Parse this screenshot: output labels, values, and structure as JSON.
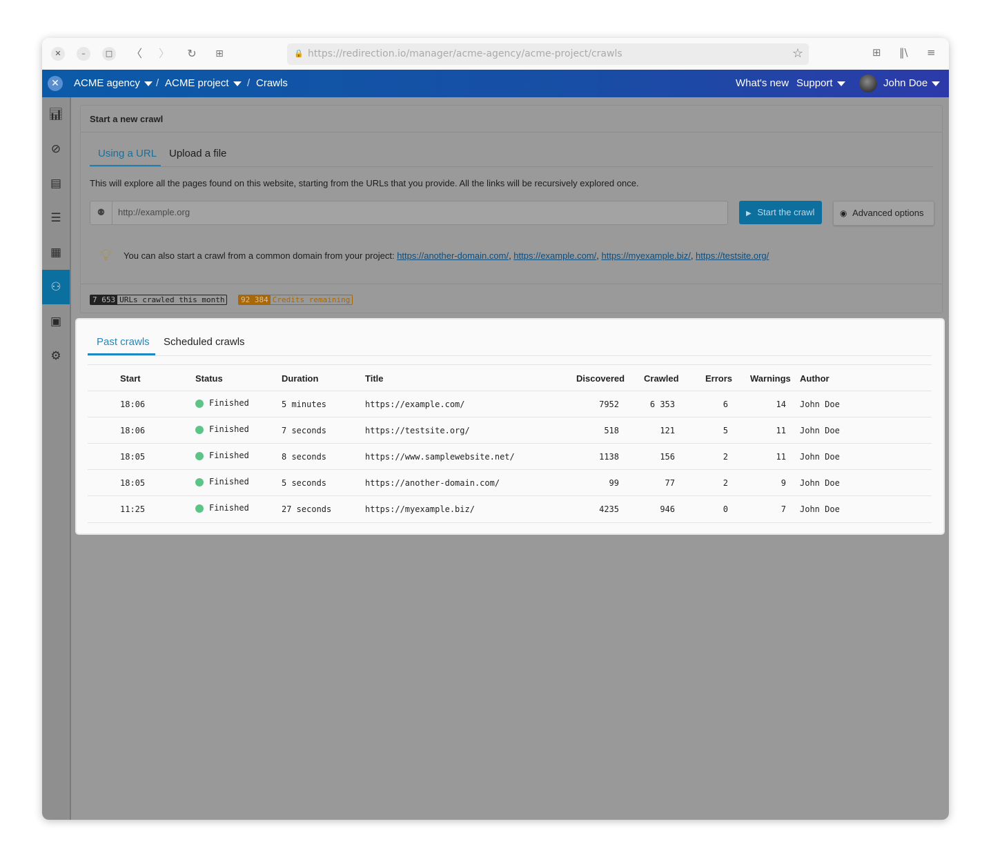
{
  "browser": {
    "url": "https://redirection.io/manager/acme-agency/acme-project/crawls"
  },
  "topbar": {
    "org": "ACME agency",
    "project": "ACME project",
    "page": "Crawls",
    "separator": "/",
    "whats_new": "What's new",
    "support": "Support",
    "user": "John Doe"
  },
  "new_crawl": {
    "title": "Start a new crawl",
    "tabs": [
      "Using a URL",
      "Upload a file"
    ],
    "description": "This will explore all the pages found on this website, starting from the URLs that you provide. All the links will be recursively explored once.",
    "url_placeholder": "http://example.org",
    "start_label": "Start the crawl",
    "advanced_label": "Advanced options",
    "hint": "You can also start a crawl from a common domain from your project:",
    "domains": [
      "https://another-domain.com/",
      "https://example.com/",
      "https://myexample.biz/",
      "https://testsite.org/"
    ],
    "urls_crawled_count": "7 653",
    "urls_crawled_label": "URLs crawled this month",
    "credits_count": "92 384",
    "credits_label": "Credits remaining"
  },
  "past": {
    "tabs": [
      "Past crawls",
      "Scheduled crawls"
    ],
    "columns": [
      "Start",
      "Status",
      "Duration",
      "Title",
      "Discovered",
      "Crawled",
      "Errors",
      "Warnings",
      "Author"
    ],
    "rows": [
      {
        "start": "18:06",
        "status": "Finished",
        "duration": "5 minutes",
        "title": "https://example.com/",
        "discovered": "7952",
        "crawled": "6 353",
        "errors": "6",
        "warnings": "14",
        "author": "John Doe"
      },
      {
        "start": "18:06",
        "status": "Finished",
        "duration": "7 seconds",
        "title": "https://testsite.org/",
        "discovered": "518",
        "crawled": "121",
        "errors": "5",
        "warnings": "11",
        "author": "John Doe"
      },
      {
        "start": "18:05",
        "status": "Finished",
        "duration": "8 seconds",
        "title": "https://www.samplewebsite.net/",
        "discovered": "1138",
        "crawled": "156",
        "errors": "2",
        "warnings": "11",
        "author": "John Doe"
      },
      {
        "start": "18:05",
        "status": "Finished",
        "duration": "5 seconds",
        "title": "https://another-domain.com/",
        "discovered": "99",
        "crawled": "77",
        "errors": "2",
        "warnings": "9",
        "author": "John Doe"
      },
      {
        "start": "11:25",
        "status": "Finished",
        "duration": "27 seconds",
        "title": "https://myexample.biz/",
        "discovered": "4235",
        "crawled": "946",
        "errors": "0",
        "warnings": "7",
        "author": "John Doe"
      }
    ]
  },
  "colors": {
    "accent": "#1e88c0",
    "topbar_start": "#0b5aa8",
    "topbar_end": "#2c3aa9",
    "status_finished": "#5dc487",
    "credits_badge": "#c77d0a"
  },
  "icons": {
    "sidebar": [
      "analytics-icon",
      "rules-icon",
      "logs-icon",
      "checklist-icon",
      "instances-icon",
      "crawler-icon",
      "reports-icon",
      "settings-icon"
    ]
  }
}
